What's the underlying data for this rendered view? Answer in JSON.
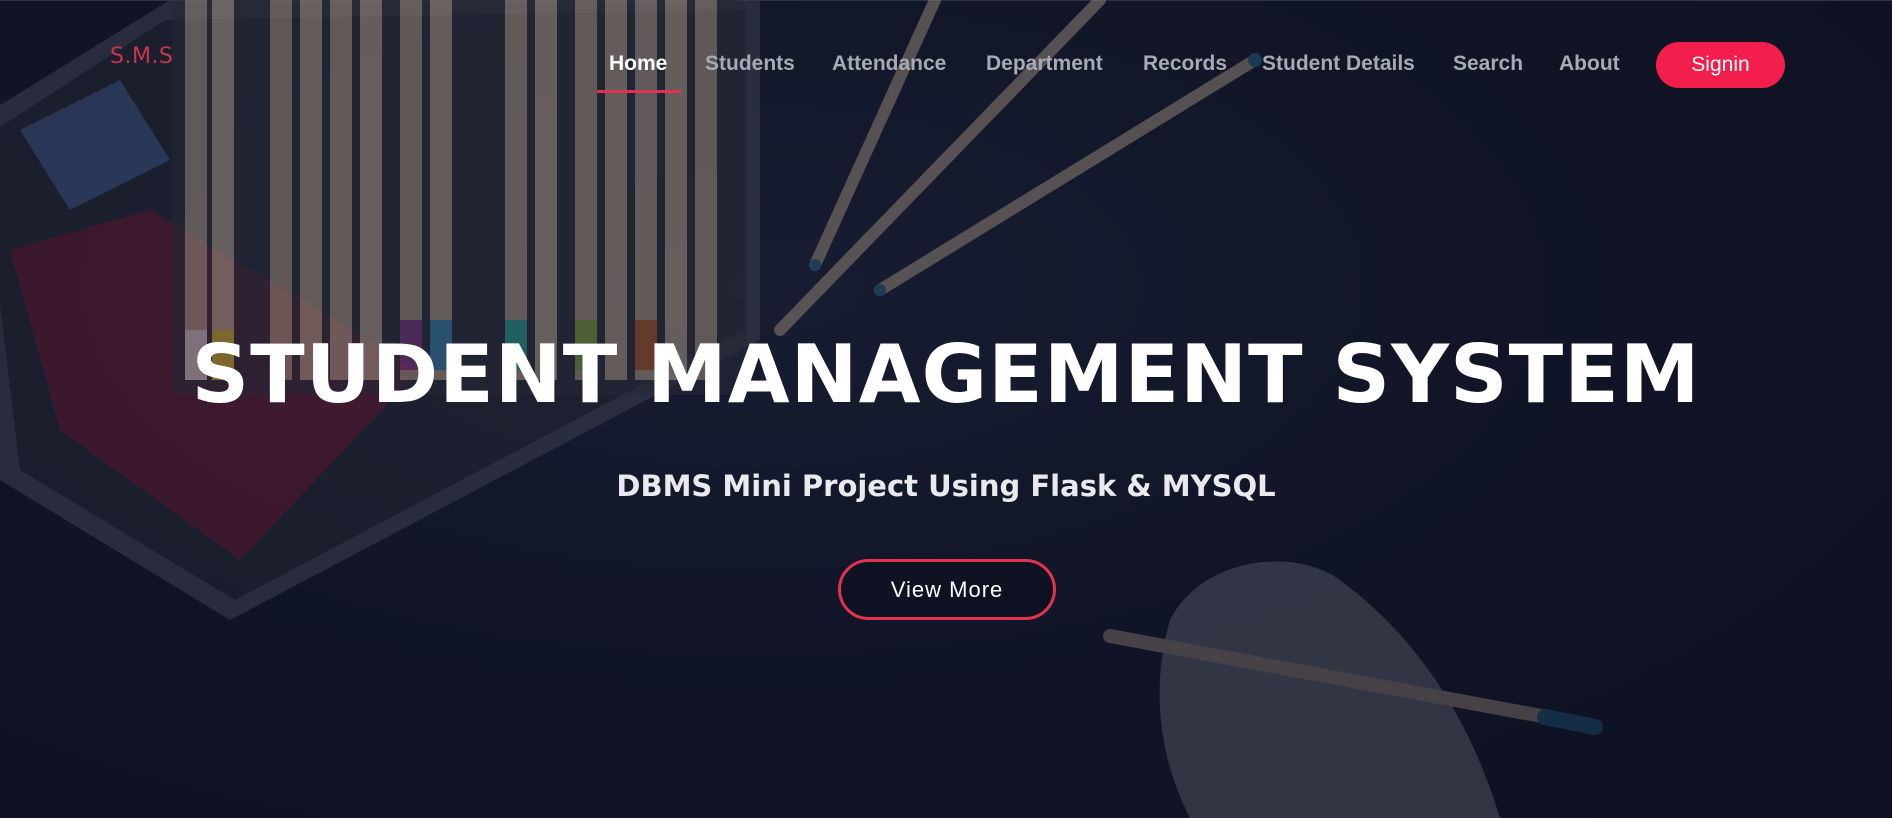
{
  "brand": {
    "logo_text": "S.M.S"
  },
  "nav": {
    "items": [
      {
        "label": "Home",
        "active": true
      },
      {
        "label": "Students",
        "active": false
      },
      {
        "label": "Attendance",
        "active": false
      },
      {
        "label": "Department",
        "active": false
      },
      {
        "label": "Records",
        "active": false
      },
      {
        "label": "Student Details",
        "active": false
      },
      {
        "label": "Search",
        "active": false
      },
      {
        "label": "About",
        "active": false
      }
    ],
    "signin_label": "Signin"
  },
  "hero": {
    "title": "STUDENT MANAGEMENT SYSTEM",
    "subtitle": "DBMS Mini Project Using Flask & MYSQL",
    "cta_label": "View More"
  },
  "colors": {
    "accent": "#f31e4b",
    "brand_text": "#c9354e",
    "background": "#121629"
  }
}
